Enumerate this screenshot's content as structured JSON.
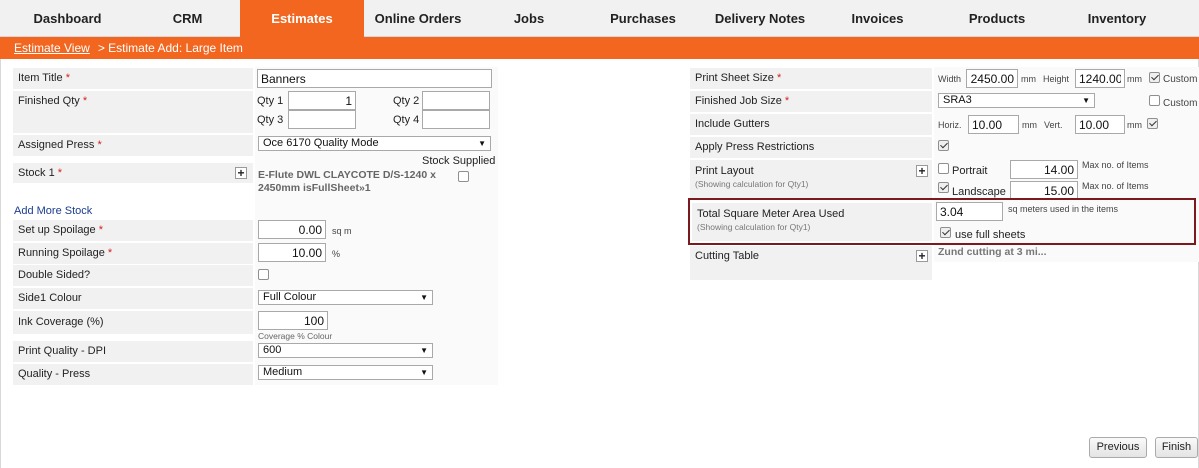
{
  "nav": {
    "tabs": [
      {
        "label": "Dashboard"
      },
      {
        "label": "CRM"
      },
      {
        "label": "Estimates"
      },
      {
        "label": "Online Orders"
      },
      {
        "label": "Jobs"
      },
      {
        "label": "Purchases"
      },
      {
        "label": "Delivery Notes"
      },
      {
        "label": "Invoices"
      },
      {
        "label": "Products"
      },
      {
        "label": "Inventory"
      }
    ],
    "active": "Estimates"
  },
  "breadcrumb": {
    "link": "Estimate View",
    "current": "> Estimate Add: Large Item"
  },
  "left": {
    "item_title_label": "Item Title",
    "item_title_value": "Banners",
    "finished_qty_label": "Finished Qty",
    "qty1_label": "Qty 1",
    "qty1_value": "1",
    "qty2_label": "Qty 2",
    "qty2_value": "",
    "qty3_label": "Qty 3",
    "qty3_value": "",
    "qty4_label": "Qty 4",
    "qty4_value": "",
    "assigned_press_label": "Assigned Press",
    "assigned_press_value": "Oce 6170 Quality Mode",
    "stock_supplied_label": "Stock Supplied",
    "stock_label": "Stock 1",
    "stock_value": "E-Flute DWL CLAYCOTE D/S-1240 x 2450mm isFullSheet»1",
    "add_more_stock": "Add More Stock",
    "setup_spoilage_label": "Set up Spoilage",
    "setup_spoilage_value": "0.00",
    "setup_spoilage_unit": "sq m",
    "running_spoilage_label": "Running Spoilage",
    "running_spoilage_value": "10.00",
    "running_spoilage_unit": "%",
    "double_sided_label": "Double Sided?",
    "side1_colour_label": "Side1 Colour",
    "side1_colour_value": "Full Colour",
    "ink_coverage_label": "Ink Coverage (%)",
    "ink_coverage_value": "100",
    "ink_coverage_note": "Coverage % Colour",
    "print_quality_label": "Print Quality - DPI",
    "print_quality_value": "600",
    "quality_press_label": "Quality - Press",
    "quality_press_value": "Medium"
  },
  "right": {
    "print_sheet_label": "Print Sheet Size",
    "width_label": "Width",
    "width_value": "2450.00",
    "height_label": "Height",
    "height_value": "1240.00",
    "mm": "mm",
    "custom_label": "Custom",
    "finished_job_label": "Finished Job Size",
    "finished_job_value": "SRA3",
    "include_gutters_label": "Include Gutters",
    "horiz_label": "Horiz.",
    "horiz_value": "10.00",
    "vert_label": "Vert.",
    "vert_value": "10.00",
    "apply_press_label": "Apply Press Restrictions",
    "print_layout_label": "Print Layout",
    "showing_calc": "(Showing calculation for Qty1)",
    "portrait_label": "Portrait",
    "portrait_value": "14.00",
    "landscape_label": "Landscape",
    "landscape_value": "15.00",
    "max_items": "Max no. of Items",
    "tsm_label": "Total Square Meter Area Used",
    "tsm_value": "3.04",
    "tsm_unit": "sq meters used in the items",
    "use_full_sheets": "use full sheets",
    "cutting_table_label": "Cutting Table",
    "cutting_value": "Zund cutting at 3 mi..."
  },
  "buttons": {
    "previous": "Previous",
    "finish": "Finish"
  },
  "colors": {
    "accent": "#f2661f",
    "highlight": "#7a1a1f"
  }
}
